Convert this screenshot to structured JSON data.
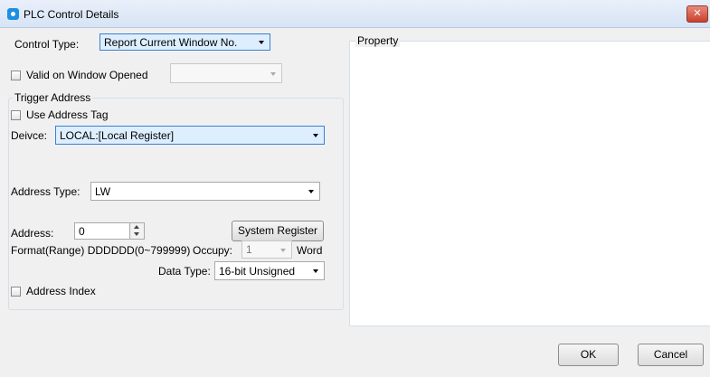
{
  "window": {
    "title": "PLC Control Details",
    "close_icon": "close-icon"
  },
  "control_type": {
    "label": "Control Type:",
    "value": "Report Current Window No."
  },
  "valid_on_window_opened": {
    "label": "Valid on Window Opened",
    "checked": false,
    "value": ""
  },
  "trigger_address": {
    "group_title": "Trigger Address",
    "use_address_tag_label": "Use Address Tag",
    "device_label": "Deivce:",
    "device_value": "LOCAL:[Local Register]",
    "address_type_label": "Address Type:",
    "address_type_value": "LW",
    "address_label": "Address:",
    "address_value": "0",
    "system_register_button": "System Register",
    "format_text": "Format(Range) DDDDDD(0~799999)",
    "occupy_label": "Occupy:",
    "occupy_value": "1",
    "occupy_unit": "Word",
    "data_type_label": "Data Type:",
    "data_type_value": "16-bit Unsigned",
    "address_index_label": "Address Index"
  },
  "property": {
    "group_title": "Property"
  },
  "buttons": {
    "ok": "OK",
    "cancel": "Cancel"
  }
}
